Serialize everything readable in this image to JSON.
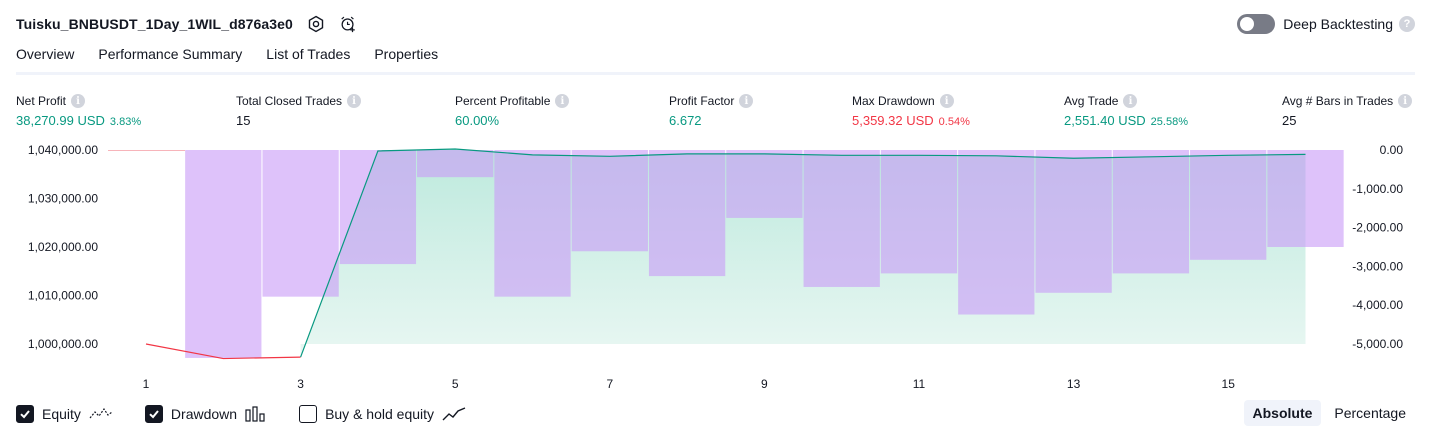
{
  "header": {
    "strategy_name": "Tuisku_BNBUSDT_1Day_1WIL_d876a3e0",
    "settings_icon": "hexagon-gear-icon",
    "alert_icon": "add-alarm-icon"
  },
  "deep_backtesting": {
    "label": "Deep Backtesting",
    "enabled": false,
    "help": "?"
  },
  "tabs": [
    {
      "label": "Overview",
      "active": true
    },
    {
      "label": "Performance Summary",
      "active": false
    },
    {
      "label": "List of Trades",
      "active": false
    },
    {
      "label": "Properties",
      "active": false
    }
  ],
  "stats": [
    {
      "label": "Net Profit",
      "value": "38,270.99 USD",
      "pct": "3.83%",
      "tone": "green"
    },
    {
      "label": "Total Closed Trades",
      "value": "15",
      "pct": "",
      "tone": "dark"
    },
    {
      "label": "Percent Profitable",
      "value": "60.00%",
      "pct": "",
      "tone": "green"
    },
    {
      "label": "Profit Factor",
      "value": "6.672",
      "pct": "",
      "tone": "green"
    },
    {
      "label": "Max Drawdown",
      "value": "5,359.32 USD",
      "pct": "0.54%",
      "tone": "red"
    },
    {
      "label": "Avg Trade",
      "value": "2,551.40 USD",
      "pct": "25.58%",
      "tone": "green"
    },
    {
      "label": "Avg # Bars in Trades",
      "value": "25",
      "pct": "",
      "tone": "dark"
    }
  ],
  "chart_data": {
    "type": "area",
    "x": [
      1,
      2,
      3,
      4,
      5,
      6,
      7,
      8,
      9,
      10,
      11,
      12,
      13,
      14,
      15,
      16
    ],
    "x_tick_labels": [
      "1",
      "3",
      "5",
      "7",
      "9",
      "11",
      "13",
      "15"
    ],
    "left_axis": {
      "ticks": [
        "1,040,000.00",
        "1,030,000.00",
        "1,020,000.00",
        "1,010,000.00",
        "1,000,000.00"
      ],
      "range": [
        997000,
        1041500
      ]
    },
    "right_axis": {
      "ticks": [
        "0.00",
        "-1,000.00",
        "-2,000.00",
        "-3,000.00",
        "-4,000.00",
        "-5,000.00"
      ],
      "range": [
        -5359.32,
        0
      ]
    },
    "series": [
      {
        "kind": "equity",
        "values": [
          1000000,
          997000,
          997300,
          1039800,
          1040200,
          1039000,
          1038700,
          1039200,
          1039200,
          1038900,
          1038900,
          1038800,
          1038300,
          1038600,
          1038900,
          1039100
        ],
        "colors": {
          "below_initial": "#f23645",
          "above_initial": "#089981",
          "fill": "#d5f0e8"
        }
      },
      {
        "kind": "drawdown",
        "values": [
          0,
          -5359.32,
          -3780,
          -2940,
          -700,
          -3780,
          -2610,
          -3250,
          -1750,
          -3530,
          -3180,
          -4240,
          -3680,
          -3180,
          -2830,
          -2500
        ],
        "color": "#c99cf7"
      }
    ],
    "grid": false
  },
  "legend": [
    {
      "label": "Equity",
      "checked": true,
      "icon": "equity-line-icon"
    },
    {
      "label": "Drawdown",
      "checked": true,
      "icon": "drawdown-bars-icon"
    },
    {
      "label": "Buy & hold equity",
      "checked": false,
      "icon": "buy-hold-line-icon"
    }
  ],
  "mode": {
    "options": [
      "Absolute",
      "Percentage"
    ],
    "selected": "Absolute"
  },
  "colors": {
    "green": "#089981",
    "red": "#f23645",
    "drawdown": "#c99cf7"
  }
}
